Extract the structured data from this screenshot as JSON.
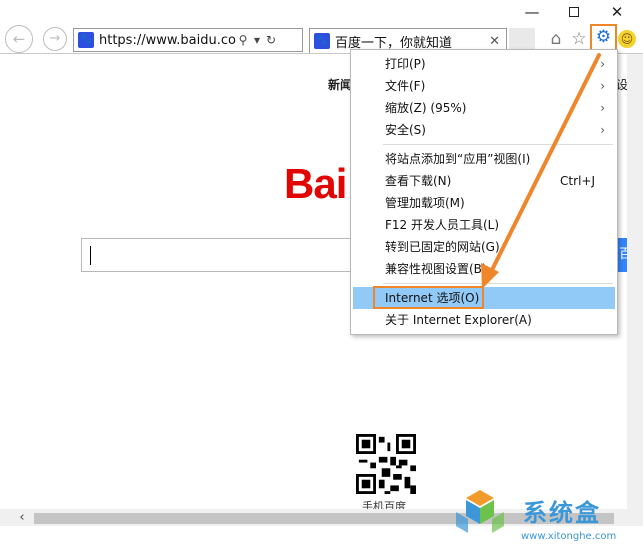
{
  "window": {
    "minimize_icon": "minimize-icon",
    "maximize_icon": "maximize-icon",
    "close_label": "✕"
  },
  "navigation": {
    "address": {
      "url": "https://www.baidu.com/",
      "favicon": "baidu-paw-icon"
    },
    "tab": {
      "title": "百度一下，你就知道",
      "close_label": "✕"
    },
    "toolbar_icons": [
      "home-icon",
      "favorites-star-icon",
      "gear-icon",
      "smiley-feedback-icon"
    ]
  },
  "page": {
    "top_link": "新闻",
    "top_link_right": "设置",
    "logo_text": "Bai",
    "search_button_label": "百",
    "qr_label": "手机百度"
  },
  "menu": {
    "items": [
      {
        "label": "打印(P)",
        "submenu": true
      },
      {
        "label": "文件(F)",
        "submenu": true
      },
      {
        "label": "缩放(Z) (95%)",
        "submenu": true
      },
      {
        "label": "安全(S)",
        "submenu": true
      },
      {
        "label": "将站点添加到“应用”视图(I)"
      },
      {
        "label": "查看下载(N)",
        "shortcut": "Ctrl+J"
      },
      {
        "label": "管理加载项(M)"
      },
      {
        "label": "F12 开发人员工具(L)"
      },
      {
        "label": "转到已固定的网站(G)"
      },
      {
        "label": "兼容性视图设置(B)"
      },
      {
        "label": "Internet 选项(O)",
        "highlighted": true
      },
      {
        "label": "关于 Internet Explorer(A)"
      }
    ],
    "submenu_arrow": "›"
  },
  "colors": {
    "annotation": "#f0862a",
    "highlight": "#91c9f7",
    "baidu_red": "#e10601",
    "baidu_blue": "#3385ff"
  },
  "watermark": {
    "text": "系统盒",
    "url": "www.xitonghe.com"
  }
}
